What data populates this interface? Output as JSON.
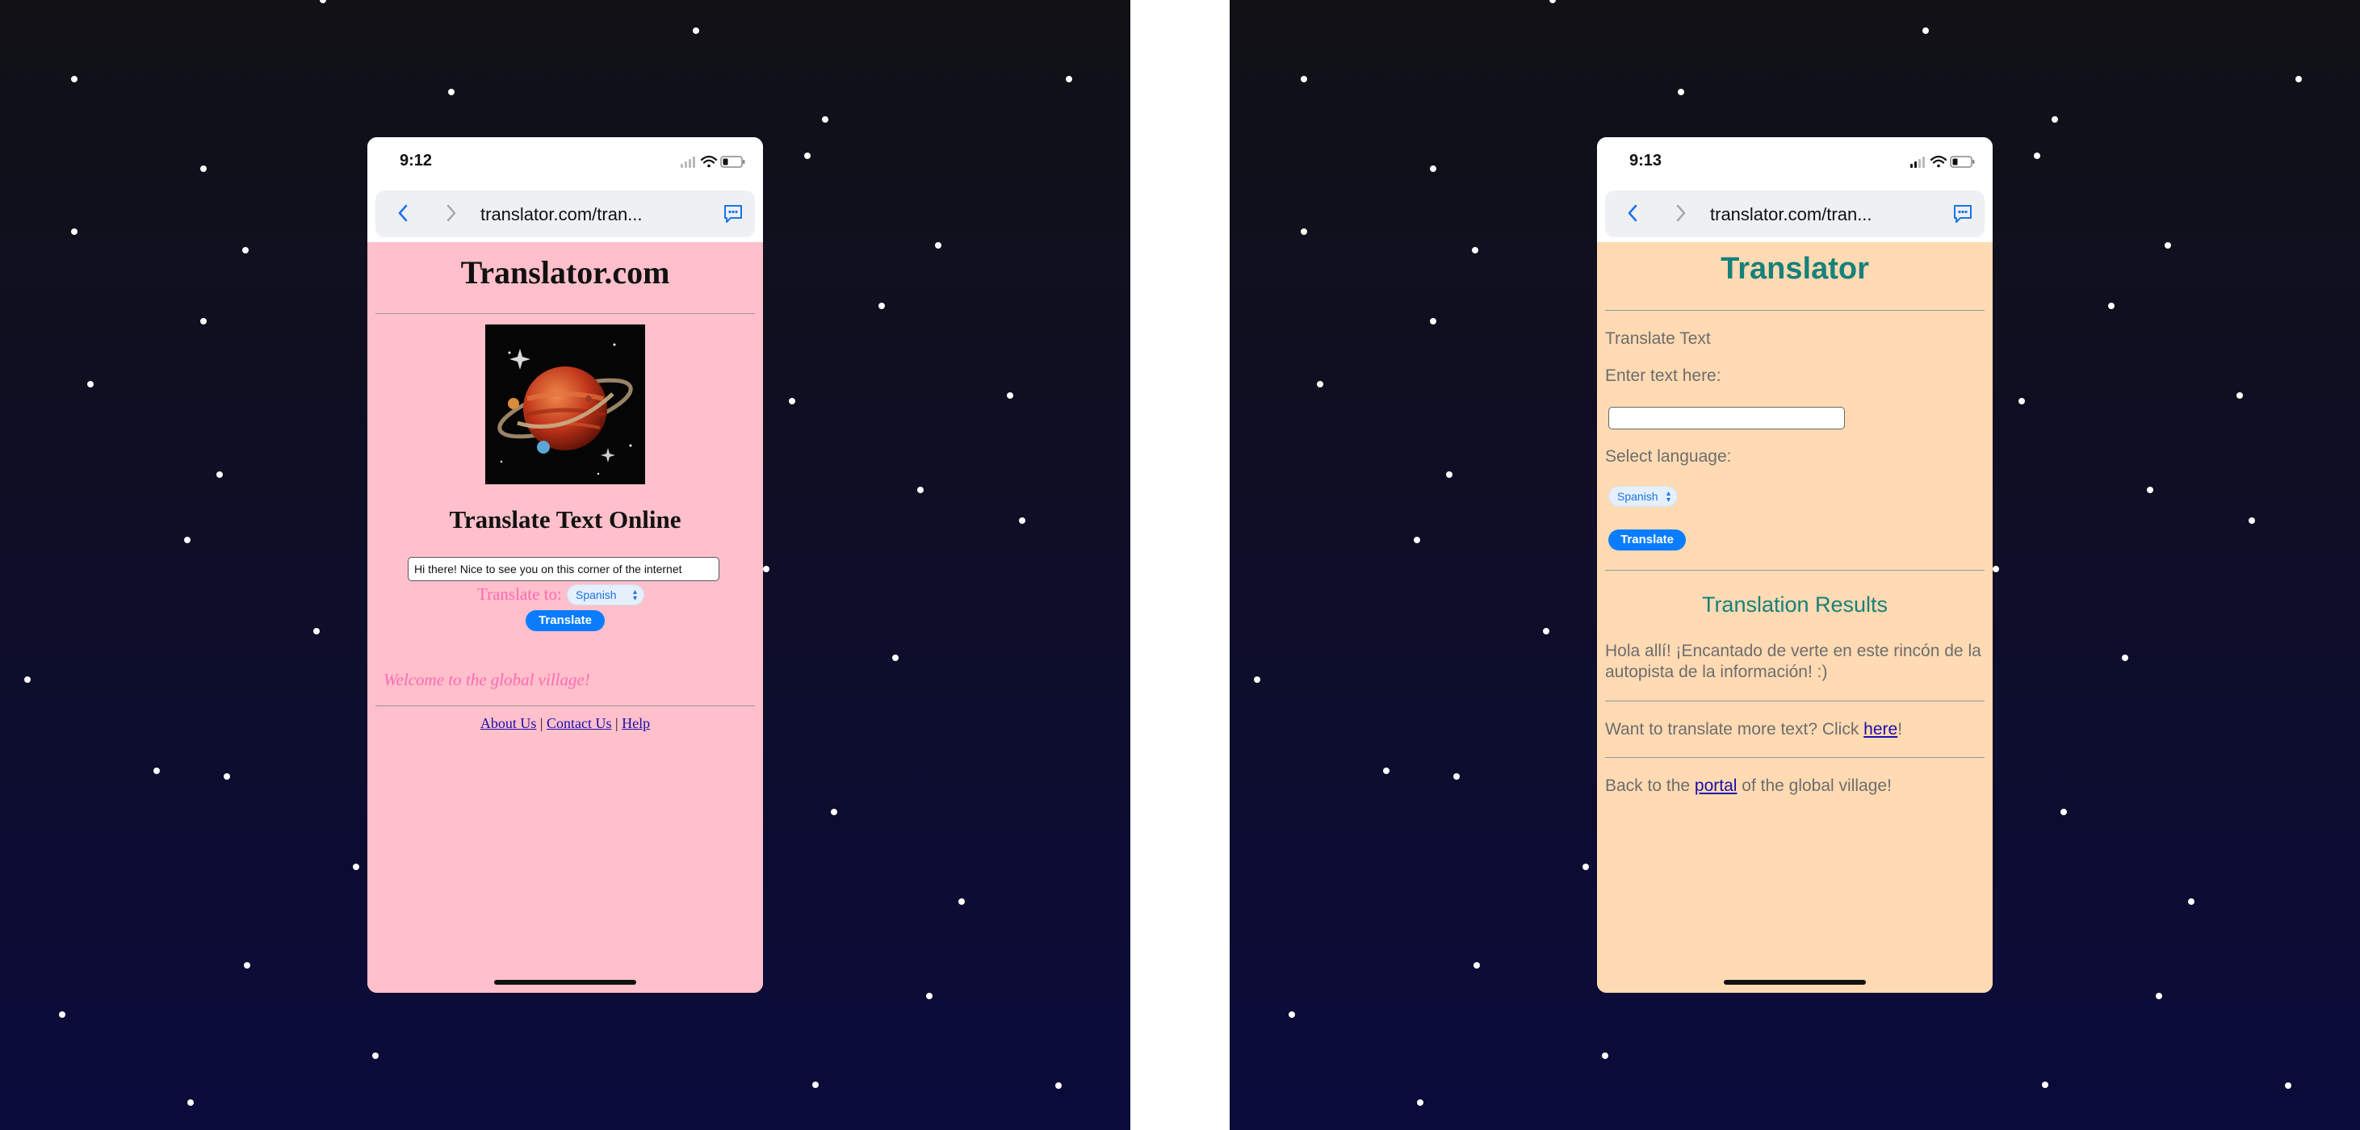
{
  "colors": {
    "left_page_background": "#ffc0cb",
    "right_page_background": "#ffdab3",
    "accent_pink": "#ff69b4",
    "accent_teal": "#17807a",
    "button_blue": "#0a7cff",
    "link_color": "#1a0dab"
  },
  "left_phone": {
    "status_bar": {
      "time": "9:12",
      "icons": [
        "signal-icon",
        "wifi-icon",
        "battery-icon"
      ]
    },
    "browser": {
      "url": "translator.com/tran...",
      "icons": [
        "back-chevron-icon",
        "forward-chevron-icon",
        "reader-icon"
      ]
    },
    "page": {
      "title": "Translator.com",
      "heading": "Translate Text Online",
      "input_value": "Hi there! Nice to see you on this corner of the internet",
      "translate_to_label": "Translate to:",
      "language": "Spanish",
      "button": "Translate",
      "welcome": "Welcome to the global village!",
      "footer": {
        "about": "About Us",
        "sep1": " | ",
        "contact": "Contact Us",
        "sep2": " | ",
        "help": "Help"
      }
    }
  },
  "right_phone": {
    "status_bar": {
      "time": "9:13",
      "icons": [
        "signal-icon",
        "wifi-icon",
        "battery-icon"
      ]
    },
    "browser": {
      "url": "translator.com/tran...",
      "icons": [
        "back-chevron-icon",
        "forward-chevron-icon",
        "reader-icon"
      ]
    },
    "page": {
      "title": "Translator",
      "section_label": "Translate Text",
      "input_label": "Enter text here:",
      "input_value": "",
      "language_label": "Select language:",
      "language": "Spanish",
      "button": "Translate",
      "results_heading": "Translation Results",
      "translation": "Hola allí! ¡Encantado de verte en este rincón de la autopista de la información! :)",
      "more": {
        "prefix": "Want to translate more text? Click ",
        "link": "here",
        "suffix": "!"
      },
      "back": {
        "prefix": "Back to the ",
        "link": "portal",
        "suffix": " of the global village!"
      }
    }
  }
}
